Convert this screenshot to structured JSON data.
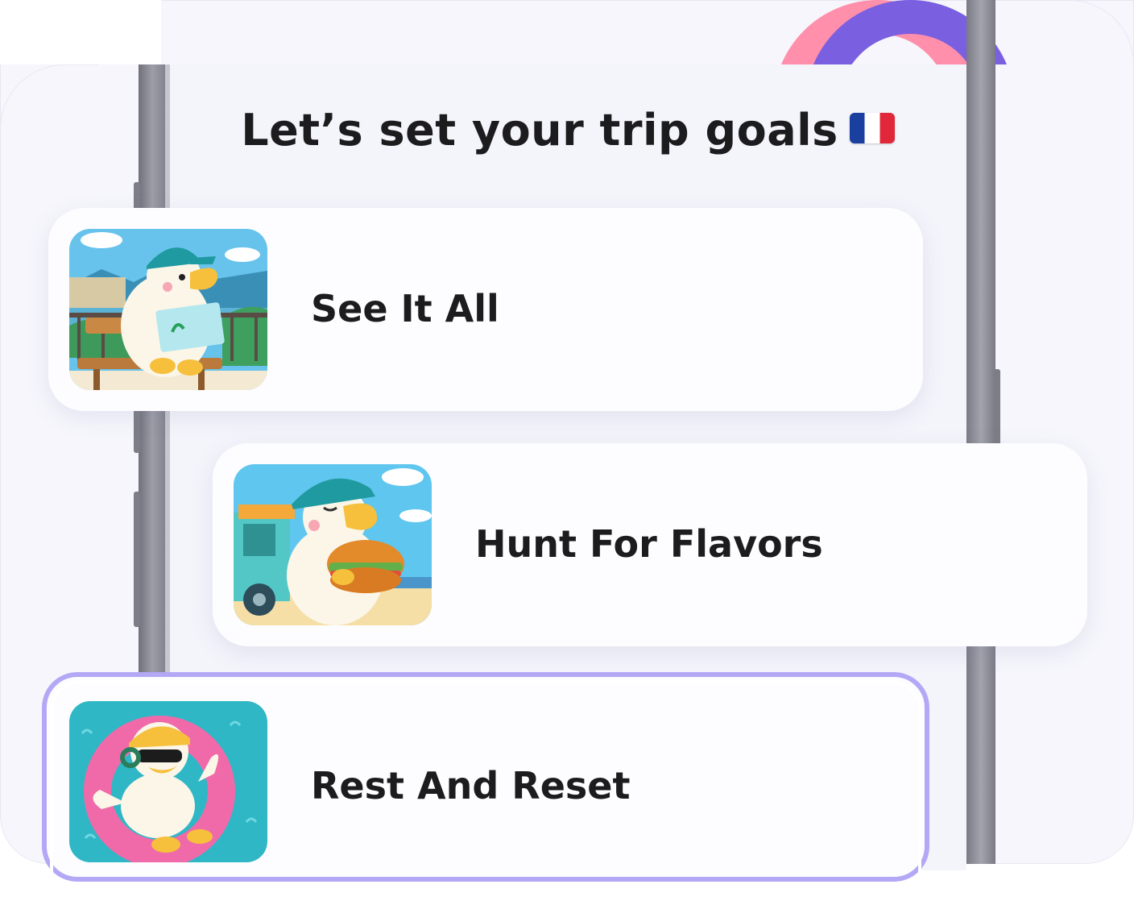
{
  "page": {
    "title": "Let’s set your trip goals",
    "flag_icon": "france-flag-icon"
  },
  "goals": [
    {
      "label": "See It All",
      "illustration": "duck-reading-map-icon",
      "selected": false
    },
    {
      "label": "Hunt For Flavors",
      "illustration": "duck-eating-sandwich-icon",
      "selected": false
    },
    {
      "label": "Rest And Reset",
      "illustration": "duck-floating-pool-icon",
      "selected": true
    }
  ],
  "colors": {
    "accent_pink": "#ff8fab",
    "accent_purple": "#7a5fe0",
    "selected_border": "#b3a8f6",
    "text": "#1c1c1f"
  }
}
